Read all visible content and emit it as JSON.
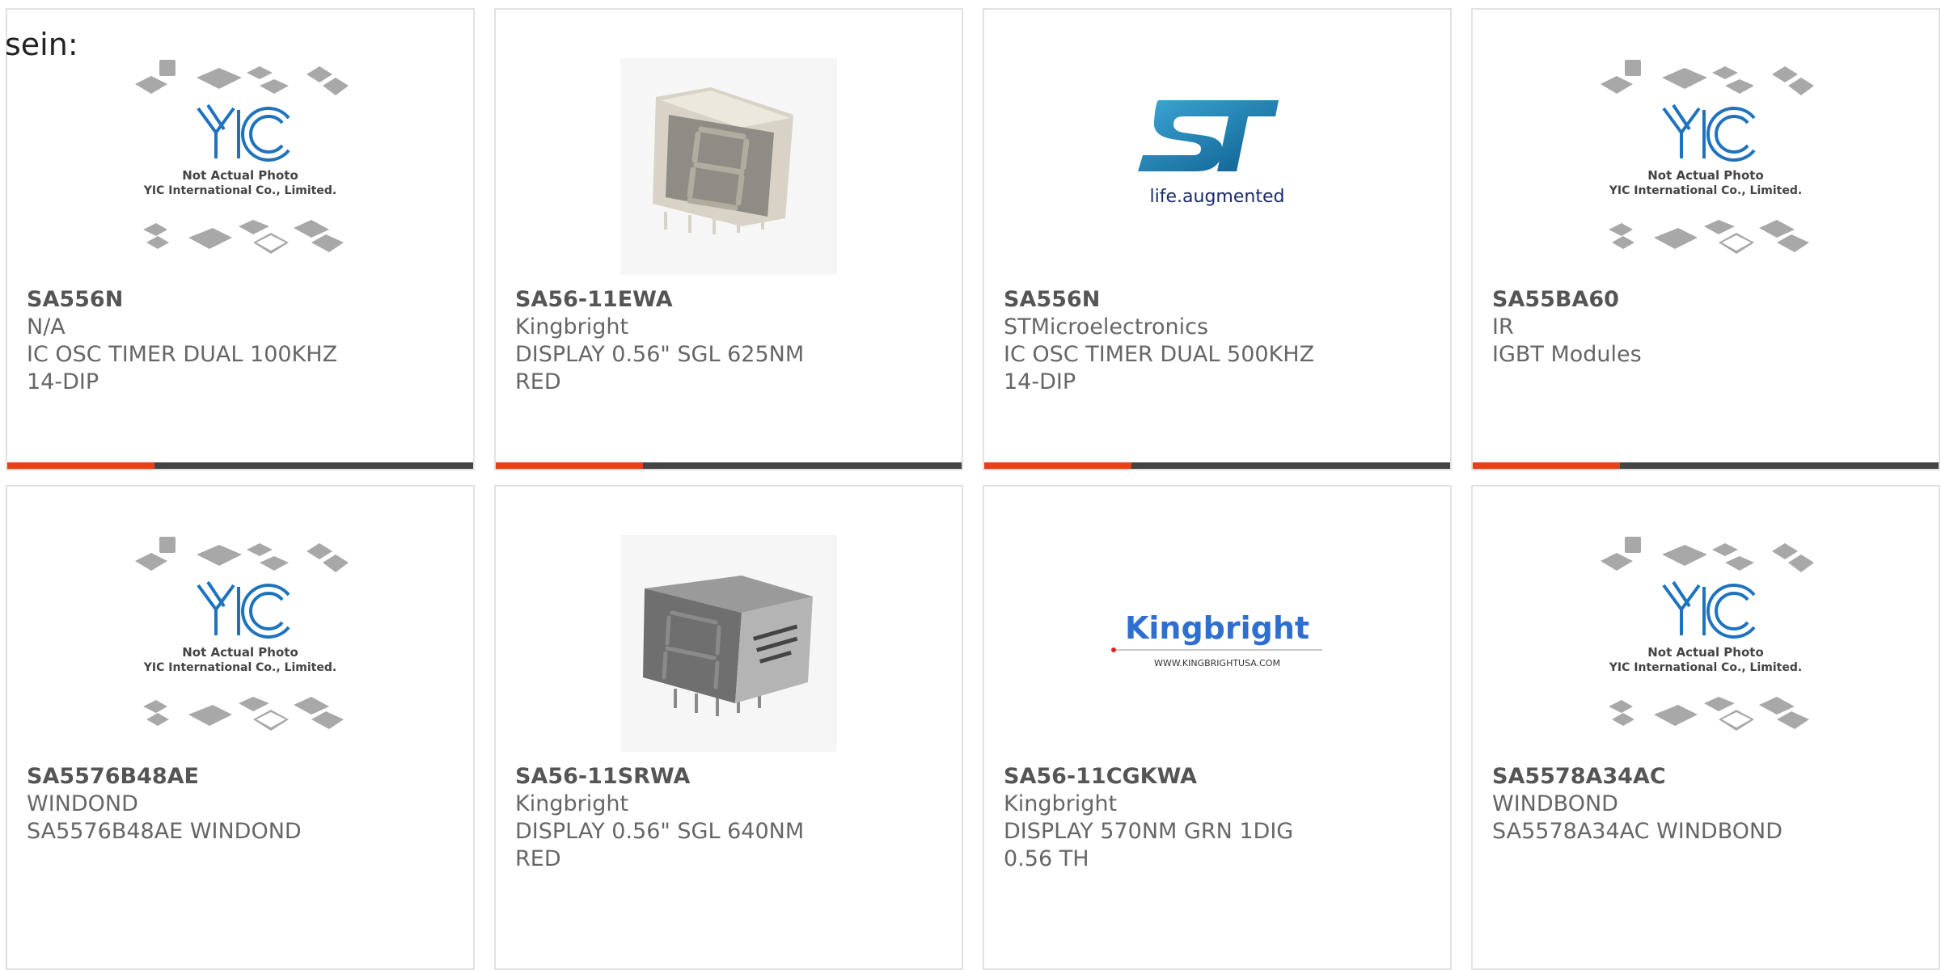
{
  "intro": {
    "text": "sein:"
  },
  "colors": {
    "accent": "#e8401c",
    "bar": "#444444",
    "border": "#e2e2e2"
  },
  "images": {
    "yic": {
      "brand": "YIC",
      "line1": "Not Actual Photo",
      "line2": "YIC International Co., Limited."
    },
    "st": {
      "tagline": "life.augmented"
    },
    "kingbright": {
      "brand": "Kingbright",
      "url": "WWW.KINGBRIGHTUSA.COM"
    }
  },
  "products": [
    {
      "part": "SA556N",
      "maker": "N/A",
      "desc": "IC OSC TIMER DUAL 100KHZ 14-DIP",
      "image": "yic-placeholder-image"
    },
    {
      "part": "SA56-11EWA",
      "maker": "Kingbright",
      "desc": "DISPLAY 0.56\" SGL 625NM RED",
      "image": "seven-segment-display-image"
    },
    {
      "part": "SA556N",
      "maker": "STMicroelectronics",
      "desc": "IC OSC TIMER DUAL 500KHZ 14-DIP",
      "image": "st-logo-image"
    },
    {
      "part": "SA55BA60",
      "maker": "IR",
      "desc": "IGBT Modules",
      "image": "yic-placeholder-image"
    },
    {
      "part": "SA5576B48AE",
      "maker": "WINDOND",
      "desc": "SA5576B48AE WINDOND",
      "image": "yic-placeholder-image"
    },
    {
      "part": "SA56-11SRWA",
      "maker": "Kingbright",
      "desc": "DISPLAY 0.56\" SGL 640NM RED",
      "image": "seven-segment-display-image"
    },
    {
      "part": "SA56-11CGKWA",
      "maker": "Kingbright",
      "desc": "DISPLAY 570NM GRN 1DIG 0.56 TH",
      "image": "kingbright-logo-image"
    },
    {
      "part": "SA5578A34AC",
      "maker": "WINDBOND",
      "desc": "SA5578A34AC WINDBOND",
      "image": "yic-placeholder-image"
    }
  ]
}
